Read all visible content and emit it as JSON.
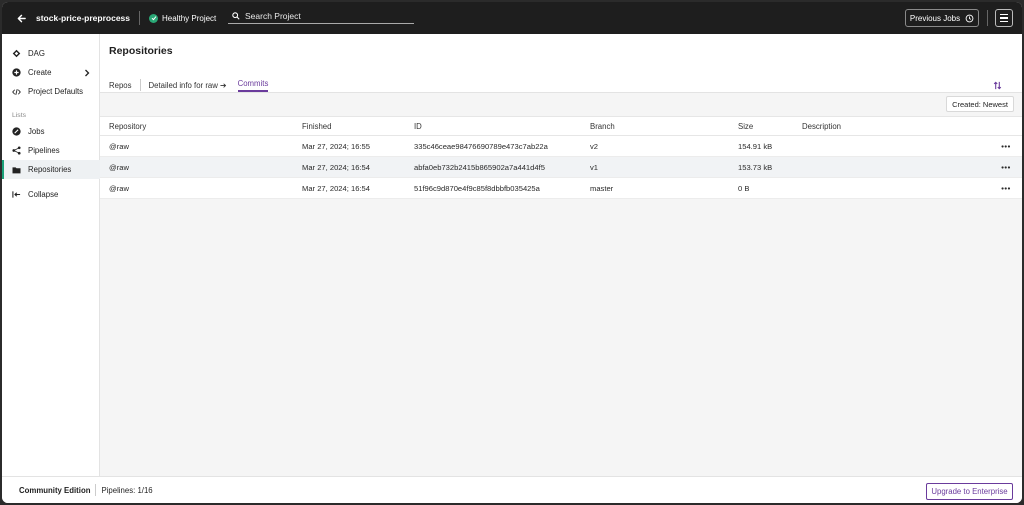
{
  "header": {
    "project_name": "stock-price-preprocess",
    "health_status": "Healthy Project",
    "search_placeholder": "Search Project",
    "previous_jobs_label": "Previous Jobs"
  },
  "sidebar": {
    "items": [
      {
        "label": "DAG",
        "icon": "dag-icon"
      },
      {
        "label": "Create",
        "icon": "plus-circle-icon"
      },
      {
        "label": "Project Defaults",
        "icon": "code-icon"
      }
    ],
    "lists_heading": "Lists",
    "list_items": [
      {
        "label": "Jobs",
        "icon": "jobs-icon"
      },
      {
        "label": "Pipelines",
        "icon": "pipelines-icon"
      },
      {
        "label": "Repositories",
        "icon": "folder-icon",
        "active": true
      }
    ],
    "collapse_label": "Collapse"
  },
  "main": {
    "title": "Repositories",
    "tabs": [
      {
        "label": "Repos"
      },
      {
        "label": "Detailed info for raw ➔"
      },
      {
        "label": "Commits",
        "active": true
      }
    ],
    "sort_label": "Created: Newest",
    "columns": [
      "Repository",
      "Finished",
      "ID",
      "Branch",
      "Size",
      "Description"
    ],
    "rows": [
      {
        "repository": "@raw",
        "finished": "Mar 27, 2024; 16:55",
        "id": "335c46ceae98476690789e473c7ab22a",
        "branch": "v2",
        "size": "154.91 kB",
        "description": ""
      },
      {
        "repository": "@raw",
        "finished": "Mar 27, 2024; 16:54",
        "id": "abfa0eb732b2415b865902a7a441d4f5",
        "branch": "v1",
        "size": "153.73 kB",
        "description": ""
      },
      {
        "repository": "@raw",
        "finished": "Mar 27, 2024; 16:54",
        "id": "51f96c9d870e4f9c85f8dbbfb035425a",
        "branch": "master",
        "size": "0 B",
        "description": ""
      }
    ],
    "row_menu_glyph": "•••"
  },
  "footer": {
    "edition": "Community Edition",
    "pipelines": "Pipelines: 1/16",
    "upgrade_label": "Upgrade to Enterprise"
  },
  "colors": {
    "header_bg": "#1e1e1e",
    "accent_purple": "#6a3b9c",
    "healthy_green": "#2aa876",
    "active_green": "#1aa179"
  }
}
